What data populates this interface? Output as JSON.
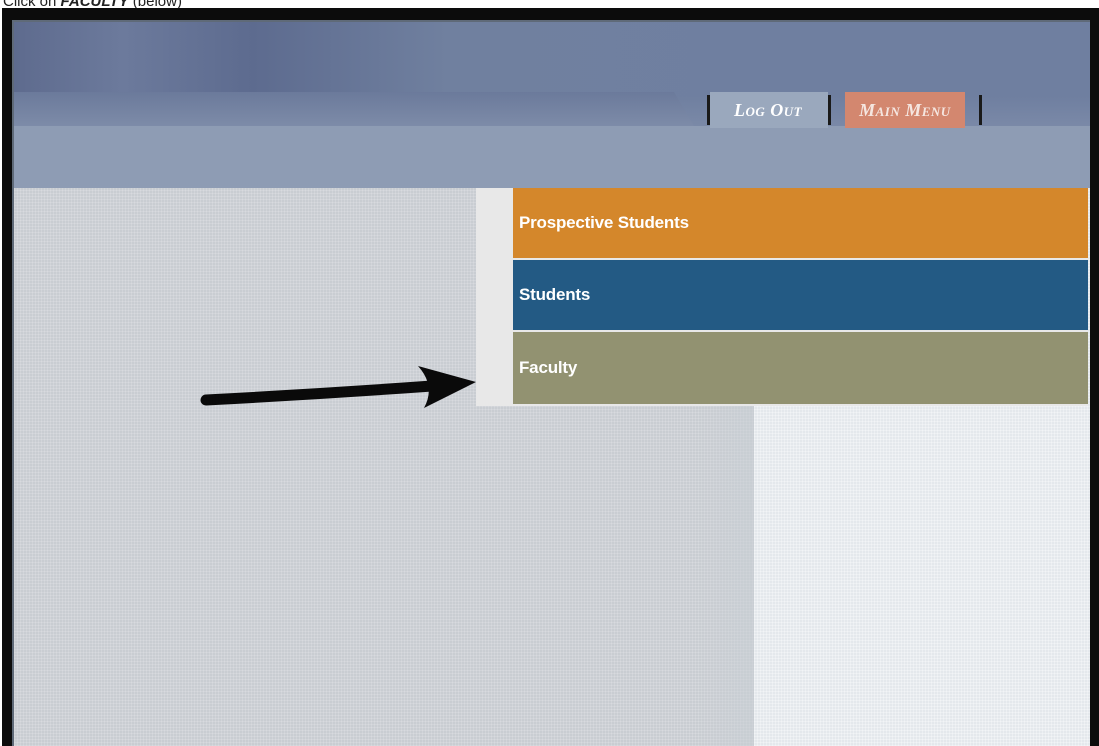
{
  "instruction": {
    "prefix": "Click on",
    "target": "FACULTY",
    "suffix": "(below)"
  },
  "header": {
    "nav": {
      "logout_label": "Log Out",
      "main_menu_label": "Main Menu"
    }
  },
  "menu": {
    "items": [
      {
        "label": "Prospective Students",
        "color": "#d4872b"
      },
      {
        "label": "Students",
        "color": "#235a84"
      },
      {
        "label": "Faculty",
        "color": "#929271"
      }
    ]
  },
  "annotation": {
    "arrow_icon": "arrow-right-icon",
    "points_to": "Faculty"
  }
}
